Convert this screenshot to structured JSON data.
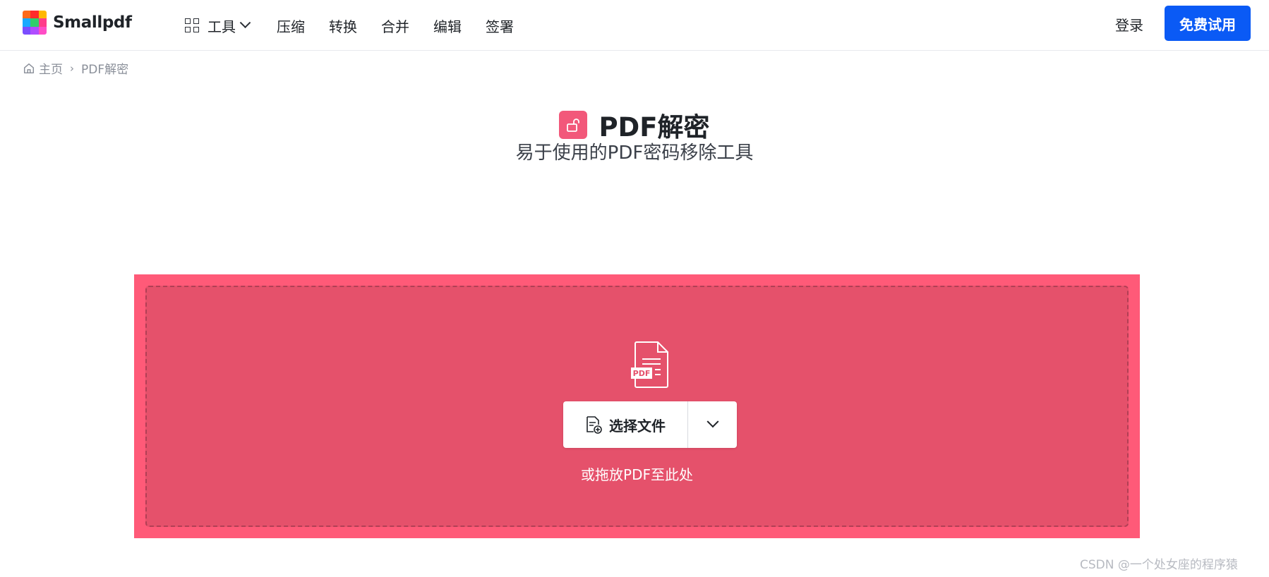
{
  "header": {
    "logo_text": "Smallpdf",
    "nav_tools_label": "工具",
    "nav_links": [
      "压缩",
      "转换",
      "合并",
      "编辑",
      "签署"
    ],
    "login_label": "登录",
    "trial_label": "免费试用"
  },
  "breadcrumb": {
    "home": "主页",
    "separator": "›",
    "current": "PDF解密"
  },
  "main": {
    "title": "PDF解密",
    "subtitle": "易于使用的PDF密码移除工具"
  },
  "dropzone": {
    "file_icon_label": "PDF",
    "choose_button": "选择文件",
    "hint": "或拖放PDF至此处"
  },
  "watermark": "CSDN @一个处女座的程序猿",
  "colors": {
    "brand_blue": "#0a5af5",
    "accent_pink": "#ff5a78",
    "dropzone_inner": "#e5516b",
    "title_icon": "#f2587a"
  }
}
